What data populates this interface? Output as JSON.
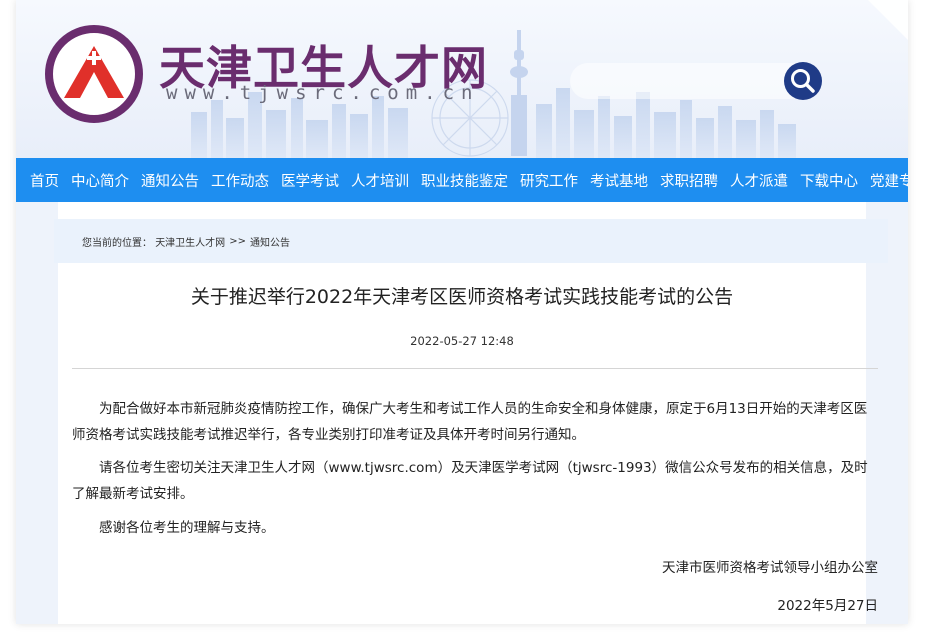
{
  "header": {
    "site_title": "天津卫生人才网",
    "site_url": "www.tjwsrc.com.cn",
    "search_placeholder": ""
  },
  "colors": {
    "nav_bg": "#1e8ef0",
    "title_purple": "#6a2d6e",
    "search_button": "#1f3b87",
    "logo_red": "#e0302a"
  },
  "nav": {
    "items": [
      "首页",
      "中心简介",
      "通知公告",
      "工作动态",
      "医学考试",
      "人才培训",
      "职业技能鉴定",
      "研究工作",
      "考试基地",
      "求职招聘",
      "人才派遣",
      "下载中心",
      "党建专栏"
    ]
  },
  "breadcrumb": {
    "prefix": "您当前的位置：",
    "home": "天津卫生人才网",
    "separator": ">>",
    "current": "通知公告"
  },
  "article": {
    "title": "关于推迟举行2022年天津考区医师资格考试实践技能考试的公告",
    "datetime": "2022-05-27 12:48",
    "paragraphs": [
      "为配合做好本市新冠肺炎疫情防控工作，确保广大考生和考试工作人员的生命安全和身体健康，原定于6月13日开始的天津考区医师资格考试实践技能考试推迟举行，各专业类别打印准考证及具体开考时间另行通知。",
      "请各位考生密切关注天津卫生人才网（www.tjwsrc.com）及天津医学考试网（tjwsrc-1993）微信公众号发布的相关信息，及时了解最新考试安排。",
      "感谢各位考生的理解与支持。"
    ],
    "signer": "天津市医师资格考试领导小组办公室",
    "sign_date": "2022年5月27日"
  },
  "icons": {
    "logo": "tjwsrc-logo-icon",
    "search": "search-icon"
  }
}
